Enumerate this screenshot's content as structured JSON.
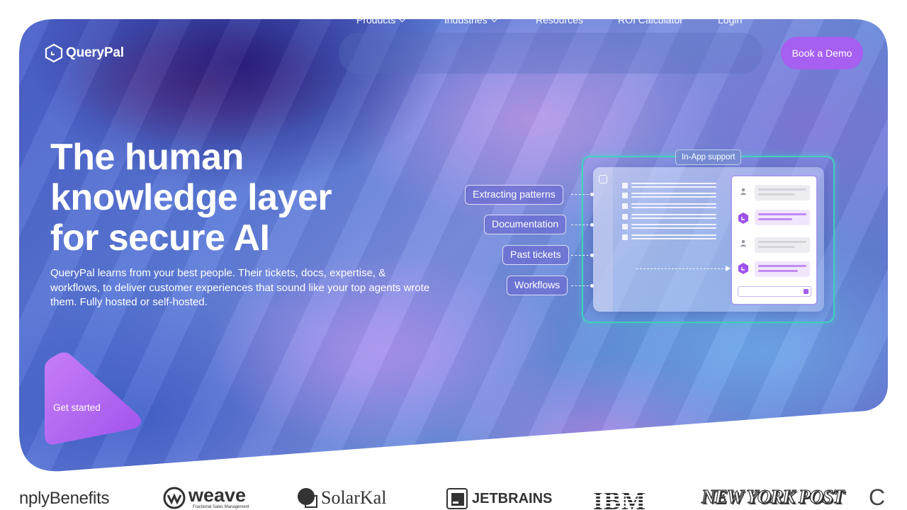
{
  "brand": {
    "name": "QueryPal"
  },
  "nav": {
    "items": [
      {
        "label": "Products",
        "has_dropdown": true
      },
      {
        "label": "Industries",
        "has_dropdown": true
      },
      {
        "label": "Resources",
        "has_dropdown": false
      },
      {
        "label": "ROI Calculator",
        "has_dropdown": false
      },
      {
        "label": "Login",
        "has_dropdown": false
      }
    ],
    "cta": "Book a Demo"
  },
  "hero": {
    "headline": [
      "The human",
      "knowledge layer",
      "for secure AI"
    ],
    "subtext": "QueryPal learns from your best people. Their tickets, docs, expertise, & workflows, to deliver customer experiences that sound like your top agents wrote them. Fully hosted or self-hosted.",
    "cta": "Get started"
  },
  "illustration": {
    "frame_label": "In-App support",
    "sources": [
      "Extracting patterns",
      "Documentation",
      "Past tickets",
      "Workflows"
    ]
  },
  "logos": [
    "nplyBenefits",
    "weave",
    "Fractional Sales Management",
    "SolarKal",
    "JETBRAINS",
    "IBM",
    "NEW YORK POST",
    "C"
  ],
  "colors": {
    "accent": "#a65ff0",
    "frame": "#3fd3c0",
    "hero_base": "#5b7ad8"
  }
}
